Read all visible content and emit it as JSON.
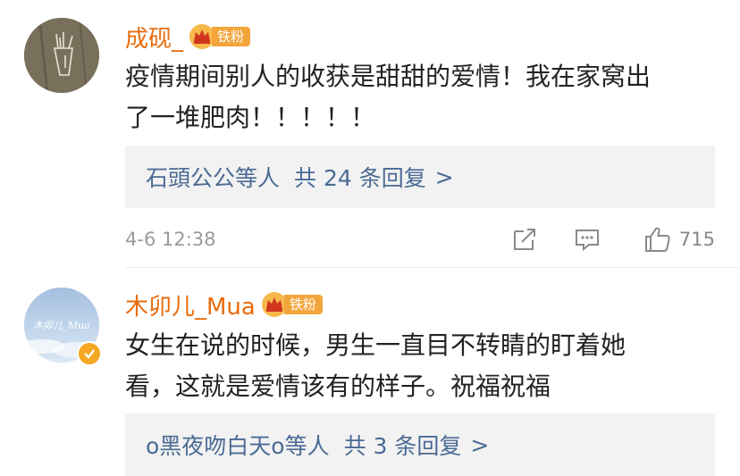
{
  "comments": [
    {
      "username": "成砚_",
      "badge": "铁粉",
      "text_line1": "疫情期间别人的收获是甜甜的爱情！我在家窝出",
      "text_line2": "了一堆肥肉！！！！！",
      "replies": {
        "who": "石頭公公等人",
        "total": "共 24 条回复",
        "arrow": ">"
      },
      "time": "4-6 12:38",
      "likes": "715",
      "icons": [
        "share-icon",
        "comment-icon",
        "like-icon"
      ]
    },
    {
      "username": "木卯儿_Mua",
      "badge": "铁粉",
      "avatar_text": "木卯儿_Mua",
      "verified": true,
      "text_line1": "女生在说的时候，男生一直目不转睛的盯着她",
      "text_line2": "看，这就是爱情该有的样子。祝福祝福",
      "replies": {
        "who": "o黑夜吻白天o等人",
        "total": "共 3 条回复",
        "arrow": ">"
      }
    }
  ],
  "colors": {
    "username": "#e86b0c",
    "link": "#4a6a94",
    "badge": "#f3a53b",
    "reply_bg": "#f2f2f2"
  }
}
